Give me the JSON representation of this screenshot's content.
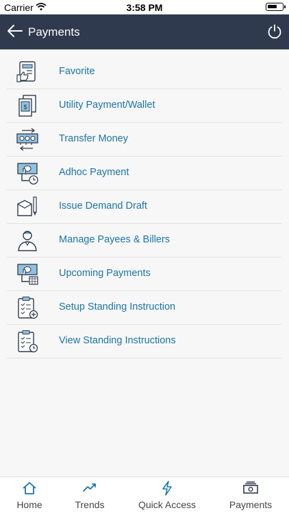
{
  "status_bar": {
    "carrier": "Carrier",
    "time": "3:58 PM"
  },
  "header": {
    "title": "Payments"
  },
  "menu": {
    "items": [
      {
        "label": "Favorite",
        "icon": "favorite-bill-icon"
      },
      {
        "label": "Utility Payment/Wallet",
        "icon": "utility-bill-icon"
      },
      {
        "label": "Transfer Money",
        "icon": "transfer-money-icon"
      },
      {
        "label": "Adhoc Payment",
        "icon": "adhoc-payment-icon"
      },
      {
        "label": "Issue Demand Draft",
        "icon": "demand-draft-icon"
      },
      {
        "label": "Manage Payees & Billers",
        "icon": "payee-person-icon"
      },
      {
        "label": "Upcoming Payments",
        "icon": "upcoming-payments-icon"
      },
      {
        "label": "Setup Standing Instruction",
        "icon": "setup-instruction-icon"
      },
      {
        "label": "View Standing Instructions",
        "icon": "view-instructions-icon"
      }
    ]
  },
  "tabbar": {
    "tabs": [
      {
        "label": "Home",
        "icon": "home-icon"
      },
      {
        "label": "Trends",
        "icon": "trends-icon"
      },
      {
        "label": "Quick Access",
        "icon": "lightning-icon"
      },
      {
        "label": "Payments",
        "icon": "payments-icon"
      }
    ]
  },
  "colors": {
    "header_bg": "#2f3a4e",
    "link": "#1b74a8",
    "tab_icon": "#1b74a8"
  }
}
